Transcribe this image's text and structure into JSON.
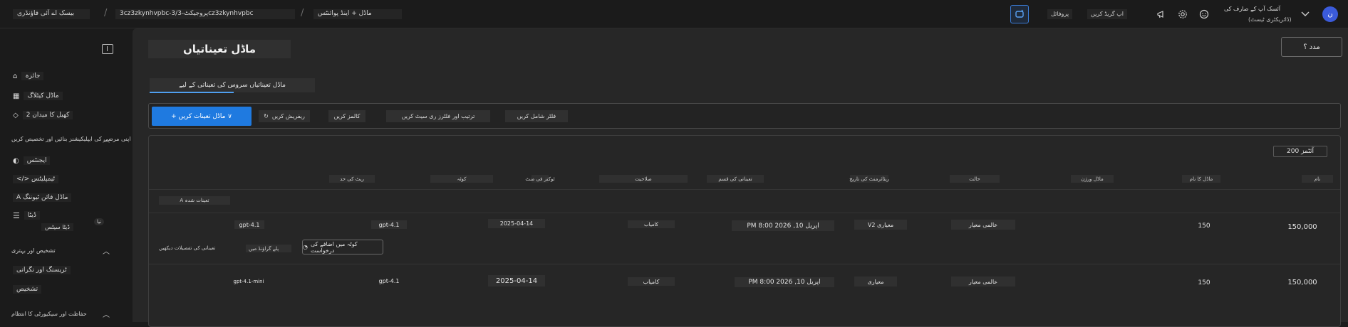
{
  "topbar": {
    "breadcrumbs": [
      "بیسک اے آئی فاؤنڈری",
      "3cz3zkynhvpbc-3/پروجیکٹ-3cz3zkynhvpbc",
      "ماڈل + اینڈ پوائنٹس"
    ],
    "separator": "/",
    "buttons": [
      "پروفائل",
      "اپ گریڈ کریں"
    ],
    "icons": [
      "copilot-icon",
      "megaphone-icon",
      "gear-icon",
      "smiley-icon",
      "chevron-down-icon"
    ],
    "user_name": "آئسک آپ کے صارف کی",
    "user_org": "(ڈائریکٹری ٹیسٹ)",
    "avatar_initial": "ن"
  },
  "sidebar": {
    "top_items": [
      {
        "icon": "home-icon",
        "label": "جائزہ"
      },
      {
        "icon": "catalog-icon",
        "label": "ماڈل کیٹلاگ"
      },
      {
        "icon": "playground-icon",
        "label": "کھیل کا میدان 2"
      }
    ],
    "section_build": "اپنی مرضی کی ایپلیکیشنز بنائیں اور تخصیص کریں",
    "build_items": [
      {
        "icon": "agents-icon",
        "label": "ایجنٹس"
      },
      {
        "icon": "code-icon",
        "label": "</> ٹیمپلیٹس"
      },
      {
        "icon": "tune-icon",
        "label": "A ماڈل فائن ٹیوننگ"
      },
      {
        "icon": "data-icon",
        "label": "ڈیٹا"
      }
    ],
    "data_sub": "ڈیٹا سیٹس",
    "badge": "نیا",
    "section_assess": "تشخیص اور بہتری",
    "assess_items": [
      {
        "icon": "trace-icon",
        "label": "ٹریسنگ اور نگرانی"
      },
      {
        "icon": "eval-icon",
        "label": "تشخیص"
      }
    ],
    "section_protect": "حفاظت اور سیکیورٹی کا انتظام"
  },
  "main": {
    "title": "ماڈل تعیناتیاں",
    "help": "مدد ؟",
    "tab": "ماڈل تعیناتیاں سروس کی تعیناتی کے لیے",
    "toolbar": {
      "primary": "+ ماڈل تعینات کریں ∨",
      "refresh": "ریفریش کریں",
      "columns": "کالمز کریں",
      "reset": "ترتیب اور فلٹرز ری سیٹ کریں",
      "filter": "فلٹر شامل کریں"
    },
    "items_per_page": "200 آئٹمز",
    "columns": [
      "نام",
      "ماڈل کا نام",
      "ماڈل ورژن",
      "حالت",
      "ریٹائرمنٹ کی تاریخ",
      "تعیناتی کی قسم",
      "صلاحیت",
      "ٹوکنز فی منٹ",
      "کوٹہ",
      "ریٹ کی حد"
    ],
    "group_label": "A تعینات شدہ",
    "rows": [
      {
        "name": "gpt-4.1",
        "model": "gpt-4.1",
        "version": "2025-04-14",
        "state": "کامیاب",
        "retirement": "PM 8:00 2026 ,10 اپریل",
        "type": "V2 معیاری",
        "capacity": "عالمی معیار",
        "quota": "150",
        "rate": "150,000"
      },
      {
        "name": "gpt-4.1-mini",
        "model": "gpt-4.1",
        "version": "2025-04-14",
        "state": "کامیاب",
        "retirement": "PM 8:00 2026 ,10 اپریل",
        "type": "معیاری",
        "capacity": "عالمی معیار",
        "quota": "150",
        "rate": "150,000"
      }
    ],
    "row_actions": {
      "link1": "تعیناتی کی تفصیلات دیکھیں",
      "link2": "پلے گراؤنڈ میں",
      "button": "کوٹہ میں اضافے کی درخواست"
    }
  }
}
